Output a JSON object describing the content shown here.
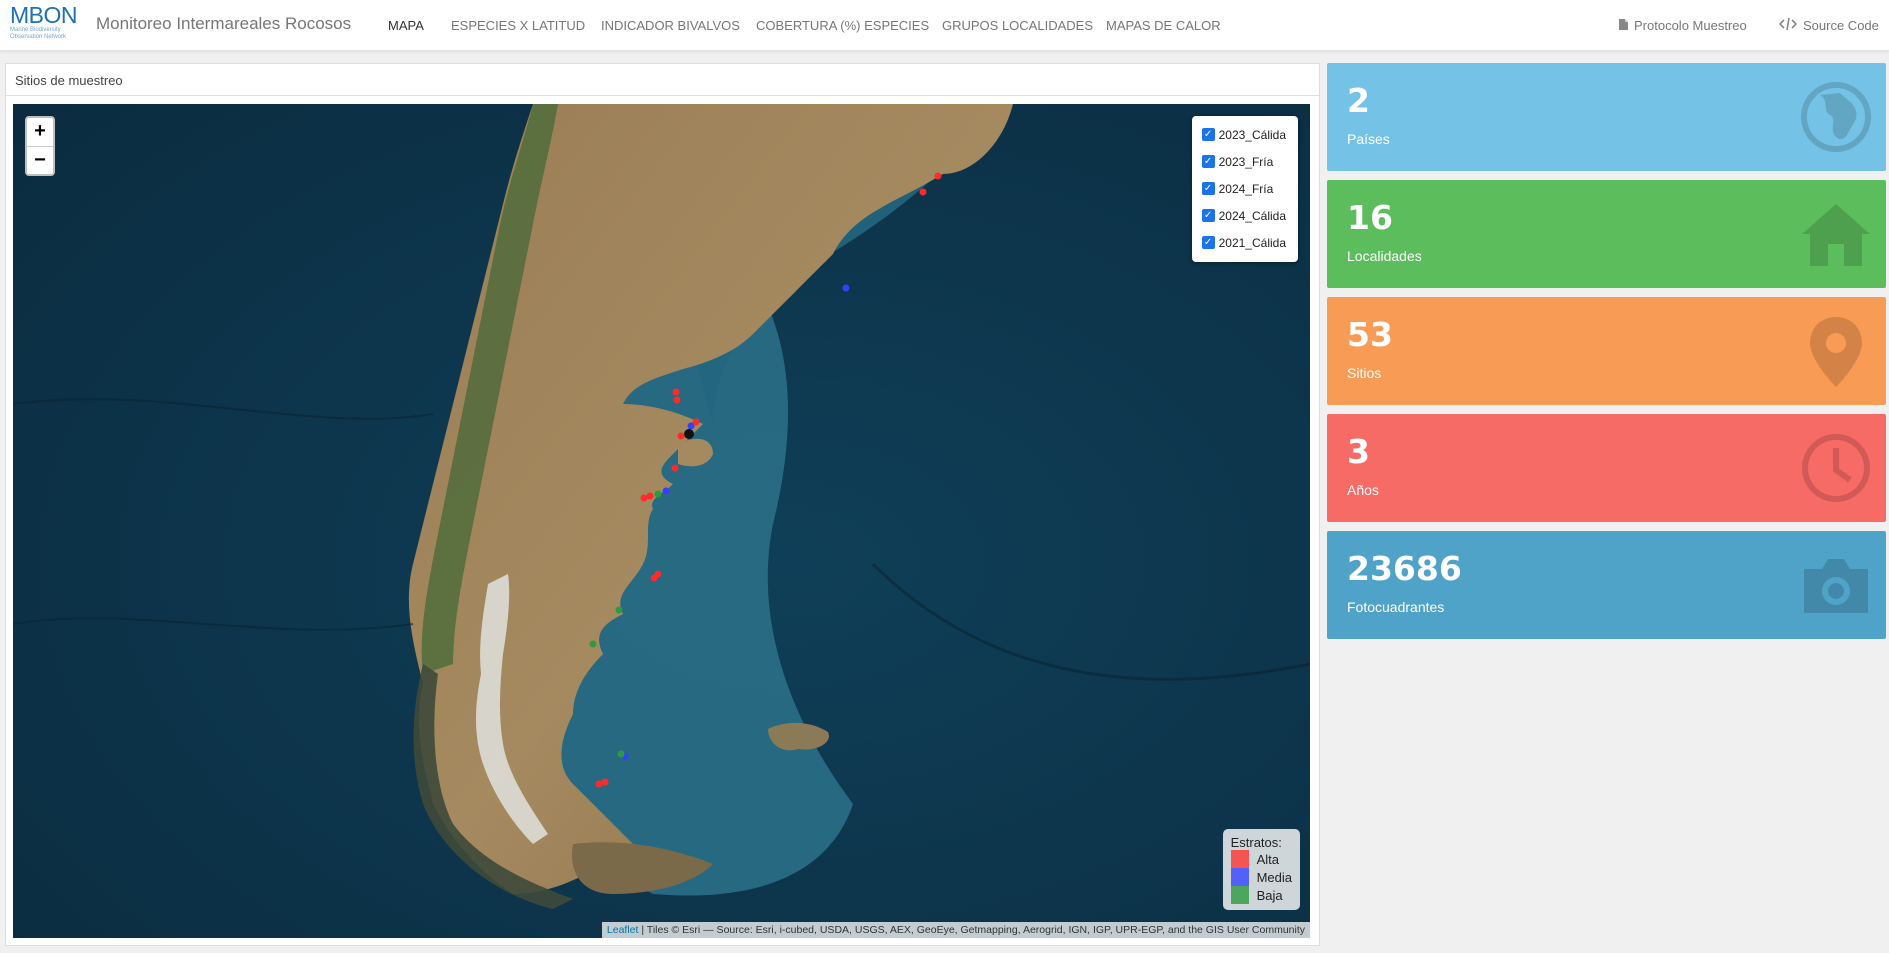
{
  "app": {
    "logo": {
      "main": "MBON",
      "sub1": "Marine Biodiversity",
      "sub2": "Observation Network"
    },
    "title": "Monitoreo Intermareales Rocosos"
  },
  "nav": {
    "tabs": [
      {
        "label": "MAPA",
        "active": true
      },
      {
        "label": "ESPECIES X LATITUD"
      },
      {
        "label": "INDICADOR BIVALVOS"
      },
      {
        "label": "COBERTURA (%) ESPECIES"
      },
      {
        "label": "GRUPOS LOCALIDADES"
      },
      {
        "label": "MAPAS DE CALOR"
      }
    ],
    "right": [
      {
        "label": "Protocolo Muestreo",
        "icon": "file-icon"
      },
      {
        "label": "Source Code",
        "icon": "code-icon"
      }
    ]
  },
  "map_panel": {
    "title": "Sitios de muestreo",
    "zoom_in": "+",
    "zoom_out": "−",
    "layers": [
      "2023_Cálida",
      "2023_Fría",
      "2024_Fría",
      "2024_Cálida",
      "2021_Cálida"
    ],
    "legend": {
      "title": "Estratos:",
      "items": [
        {
          "label": "Alta",
          "color": "#ff3333"
        },
        {
          "label": "Media",
          "color": "#3344ff"
        },
        {
          "label": "Baja",
          "color": "#2e9a3e"
        }
      ]
    },
    "attribution": {
      "link": "Leaflet",
      "text": " | Tiles © Esri — Source: Esri, i-cubed, USDA, USGS, AEX, GeoEye, Getmapping, Aerogrid, IGN, IGP, UPR-EGP, and the GIS User Community"
    }
  },
  "stats": [
    {
      "value": "2",
      "label": "Países",
      "color": "#74c3e6",
      "icon": "globe-icon"
    },
    {
      "value": "16",
      "label": "Localidades",
      "color": "#5cbd5c",
      "icon": "home-icon"
    },
    {
      "value": "53",
      "label": "Sitios",
      "color": "#f89b55",
      "icon": "map-marker-icon"
    },
    {
      "value": "3",
      "label": "Años",
      "color": "#f76b67",
      "icon": "clock-icon"
    },
    {
      "value": "23686",
      "label": "Fotocuadrantes",
      "color": "#4fa2c8",
      "icon": "camera-icon"
    }
  ]
}
